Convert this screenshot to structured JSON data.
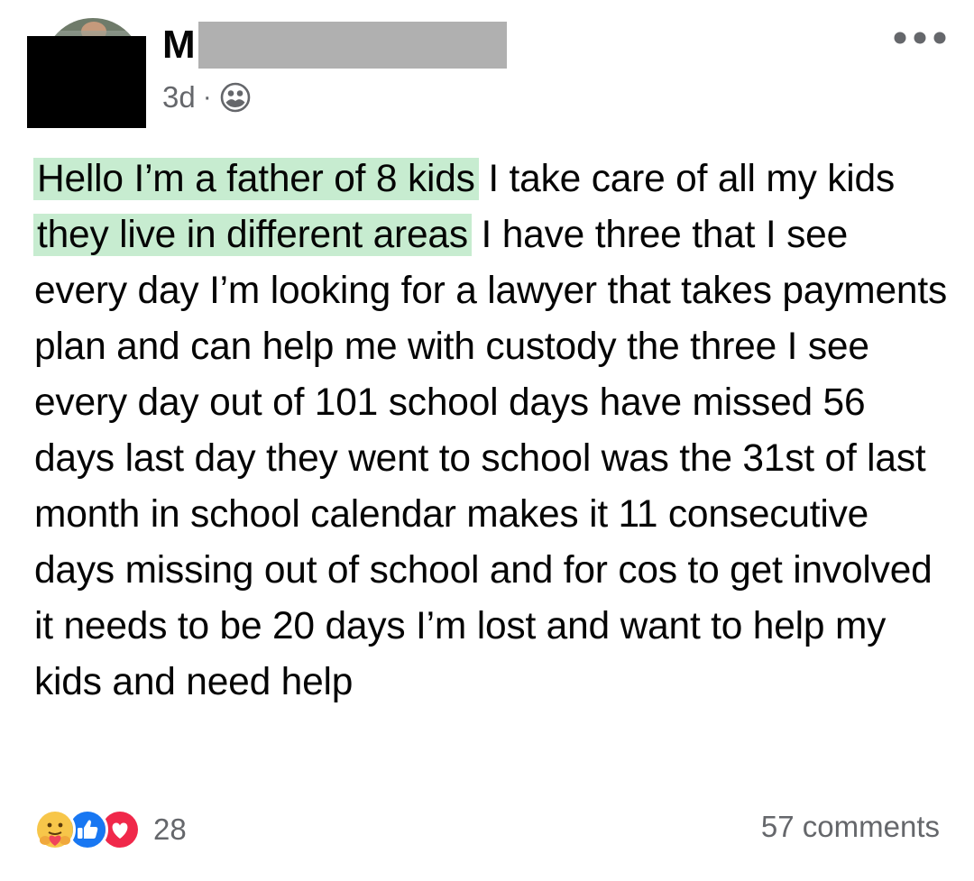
{
  "post": {
    "author": {
      "name_initial": "M"
    },
    "timestamp": "3d",
    "separator": "·",
    "audience_icon": "friends-icon",
    "more_icon": "more-horizontal-icon",
    "text_segments": [
      {
        "text": "Hello I’m a father of 8 kids",
        "highlight": true
      },
      {
        "text": " I take care of all my kids ",
        "highlight": false
      },
      {
        "text": "they live in different areas",
        "highlight": true
      },
      {
        "text": " I have three that I see every day I’m looking for a lawyer that takes payments plan and can help me with custody the three I see every day out of 101 school days have missed 56 days last day they went to school was the 31st of last month in school calendar makes it 11 consecutive days missing out of school and for cos to get involved it needs to be 20 days I’m lost and want to help my kids and need help",
        "highlight": false
      }
    ],
    "highlight_color": "#c7ecd0",
    "reactions": {
      "icons": [
        "care-icon",
        "like-icon",
        "love-icon"
      ],
      "count": "28"
    },
    "comments": "57 comments"
  }
}
